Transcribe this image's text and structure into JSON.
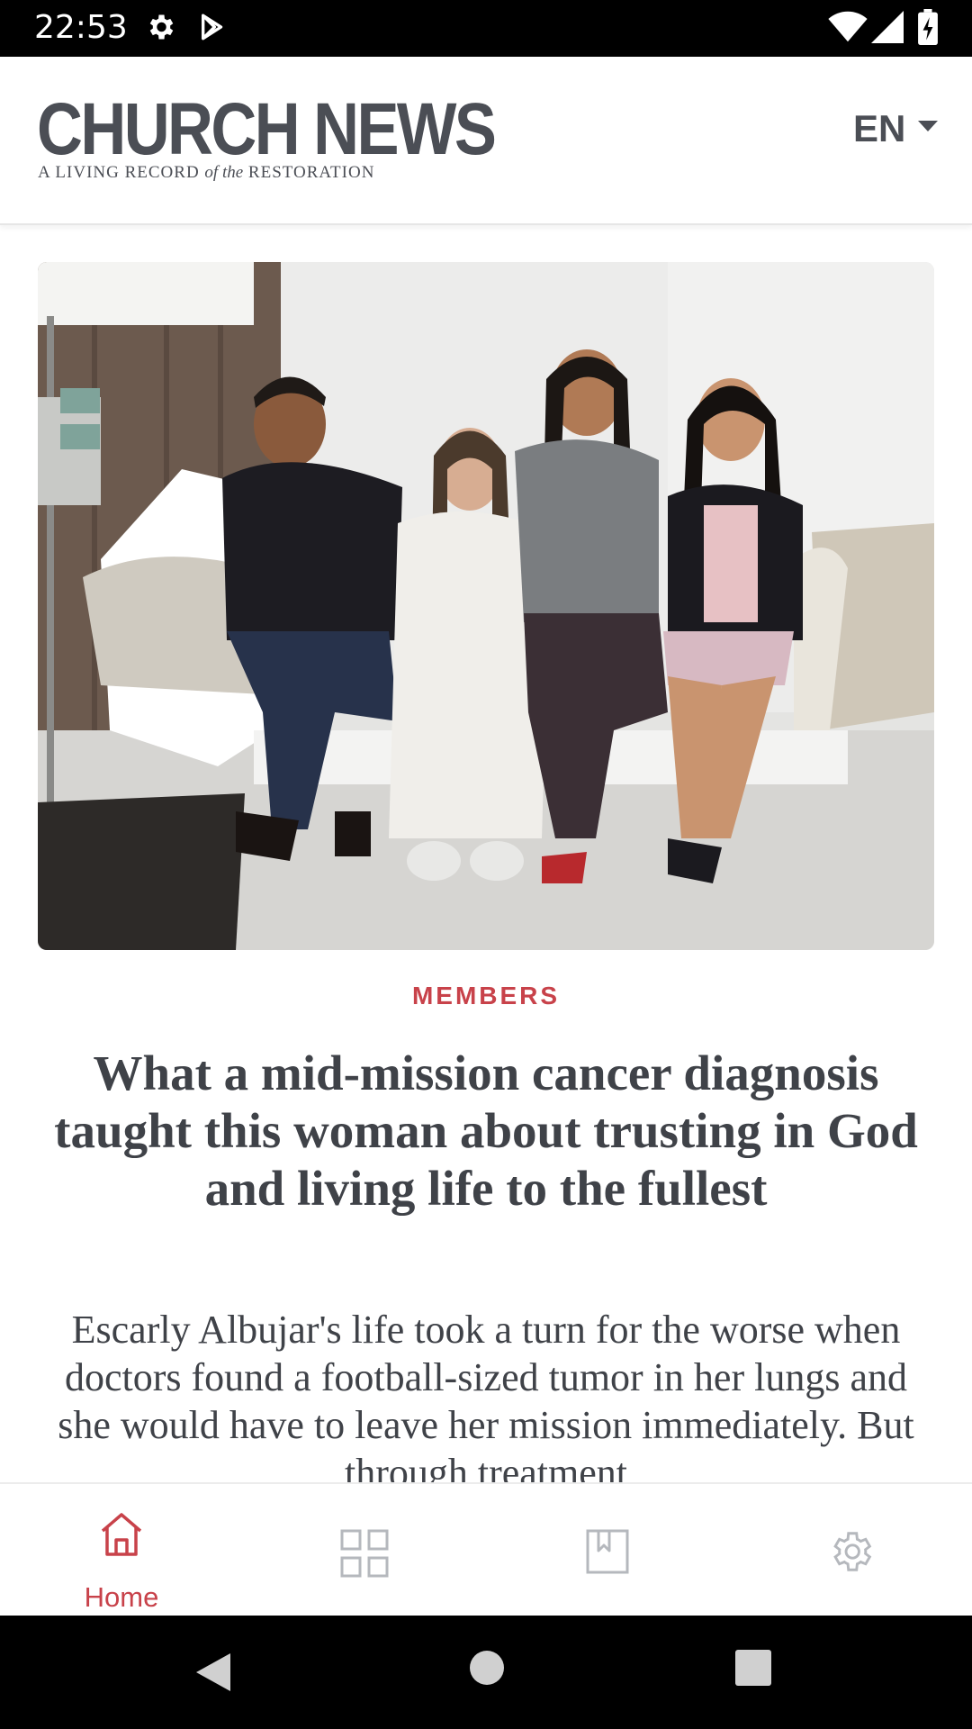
{
  "status_bar": {
    "time": "22:53",
    "icons": [
      "gear-icon",
      "play-store-icon",
      "wifi-icon",
      "signal-icon",
      "battery-icon"
    ]
  },
  "header": {
    "title": "CHURCH NEWS",
    "tagline_start": "A LIVING RECORD ",
    "tagline_italic": "of the",
    "tagline_end": " RESTORATION",
    "language": "EN"
  },
  "article": {
    "category": "MEMBERS",
    "headline": "What a mid-mission cancer diagnosis taught this woman about trusting in God and living life to the fullest",
    "summary": "Escarly Albujar's life took a turn for the worse when doctors found a football-sized tumor in her lungs and she would have to leave her mission immediately. But through treatment"
  },
  "bottom_nav": {
    "items": [
      {
        "label": "Home",
        "icon": "home-icon",
        "active": true
      },
      {
        "label": "",
        "icon": "grid-icon",
        "active": false
      },
      {
        "label": "",
        "icon": "bookmark-icon",
        "active": false
      },
      {
        "label": "",
        "icon": "settings-icon",
        "active": false
      }
    ]
  },
  "colors": {
    "accent": "#c8424a",
    "text": "#3f4248",
    "inactive_icon": "#b5b8bd"
  }
}
